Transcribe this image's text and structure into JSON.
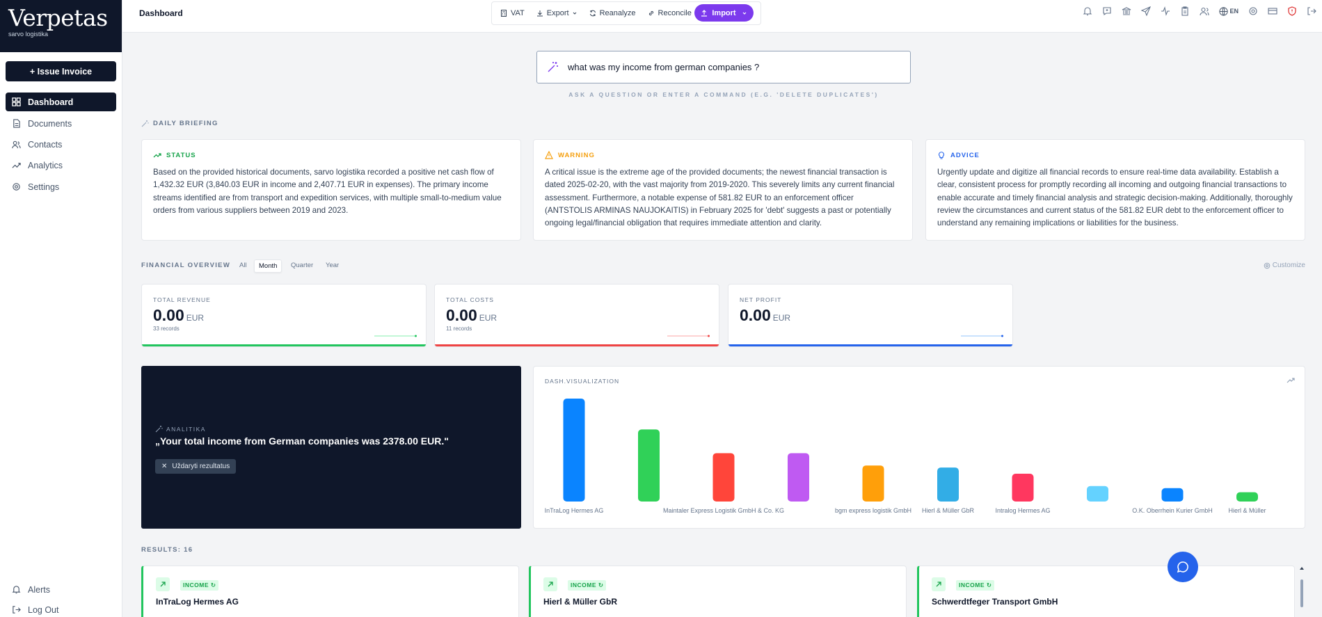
{
  "sidebar": {
    "brand": "Verpetas",
    "company": "sarvo logistika",
    "issue_invoice": "+ Issue Invoice",
    "nav": [
      {
        "label": "Dashboard",
        "icon": "grid-icon",
        "active": true
      },
      {
        "label": "Documents",
        "icon": "document-icon"
      },
      {
        "label": "Contacts",
        "icon": "users-icon"
      },
      {
        "label": "Analytics",
        "icon": "trend-icon"
      },
      {
        "label": "Settings",
        "icon": "gear-icon"
      }
    ],
    "bottom": [
      {
        "label": "Alerts",
        "icon": "bell-icon"
      },
      {
        "label": "Log Out",
        "icon": "logout-icon"
      }
    ]
  },
  "topbar": {
    "title": "Dashboard",
    "toolbar": {
      "vat": "VAT",
      "export": "Export",
      "reanalyze": "Reanalyze",
      "reconcile": "Reconcile",
      "import": "Import"
    },
    "lang": "EN",
    "icons": [
      "bell-icon",
      "message-icon",
      "bank-icon",
      "send-icon",
      "activity-icon",
      "clipboard-icon",
      "user-icon",
      "globe-icon",
      "gear-icon",
      "card-icon",
      "shield-alert-icon",
      "logout-icon"
    ]
  },
  "ask": {
    "value": "what was my income from german companies ?",
    "hint": "ASK A QUESTION OR ENTER A COMMAND (E.G. 'DELETE DUPLICATES')"
  },
  "briefing": {
    "label": "DAILY BRIEFING",
    "cards": [
      {
        "title": "STATUS",
        "color": "#16a34a",
        "text": "Based on the provided historical documents, sarvo logistika recorded a positive net cash flow of 1,432.32 EUR (3,840.03 EUR in income and 2,407.71 EUR in expenses). The primary income streams identified are from transport and expedition services, with multiple small-to-medium value orders from various suppliers between 2019 and 2023."
      },
      {
        "title": "WARNING",
        "color": "#f59e0b",
        "text": "A critical issue is the extreme age of the provided documents; the newest financial transaction is dated 2025-02-20, with the vast majority from 2019-2020. This severely limits any current financial assessment. Furthermore, a notable expense of 581.82 EUR to an enforcement officer (ANTSTOLIS ARMINAS NAUJOKAITIS) in February 2025 for 'debt' suggests a past or potentially ongoing legal/financial obligation that requires immediate attention and clarity."
      },
      {
        "title": "ADVICE",
        "color": "#2563eb",
        "text": "Urgently update and digitize all financial records to ensure real-time data availability. Establish a clear, consistent process for promptly recording all incoming and outgoing financial transactions to enable accurate and timely financial analysis and strategic decision-making. Additionally, thoroughly review the circumstances and current status of the 581.82 EUR debt to the enforcement officer to understand any remaining implications or liabilities for the business."
      }
    ]
  },
  "overview": {
    "label": "FINANCIAL OVERVIEW",
    "periods": [
      "All",
      "Month",
      "Quarter",
      "Year"
    ],
    "active_period": "Month",
    "customize": "Customize",
    "kpis": [
      {
        "label": "TOTAL REVENUE",
        "value": "0.00",
        "unit": "EUR",
        "records": "33 records",
        "color": "#22c55e"
      },
      {
        "label": "TOTAL COSTS",
        "value": "0.00",
        "unit": "EUR",
        "records": "11 records",
        "color": "#ef4444"
      },
      {
        "label": "NET PROFIT",
        "value": "0.00",
        "unit": "EUR",
        "records": "",
        "color": "#2563eb"
      }
    ]
  },
  "analitika": {
    "label": "ANALITIKA",
    "answer": "„Your total income from German companies was 2378.00 EUR.\"",
    "close": "Uždaryti rezultatus"
  },
  "viz": {
    "title": "DASH.VISUALIZATION"
  },
  "chart_data": {
    "type": "bar",
    "categories": [
      "InTraLog Hermes AG",
      "",
      "Maintaler Express Logistik GmbH & Co. KG",
      "",
      "bgm express logistik GmbH",
      "Hierl & Müller GbR",
      "Intralog Hermes AG",
      "",
      "O.K. Oberrhein Kurier GmbH",
      "Hierl & Müller"
    ],
    "values": [
      100,
      70,
      47,
      47,
      35,
      33,
      27,
      15,
      13,
      9
    ],
    "colors": [
      "#0a84ff",
      "#30d158",
      "#ff453a",
      "#bf5af2",
      "#ff9f0a",
      "#32ade6",
      "#ff375f",
      "#64d2ff",
      "#0a84ff",
      "#30d158"
    ],
    "title": "DASH.VISUALIZATION",
    "xlabel": "",
    "ylabel": "",
    "grid": false
  },
  "results": {
    "label": "RESULTS: 16",
    "items": [
      {
        "tag": "INCOME",
        "name": "InTraLog Hermes AG"
      },
      {
        "tag": "INCOME",
        "name": "Hierl & Müller GbR"
      },
      {
        "tag": "INCOME",
        "name": "Schwerdtfeger Transport GmbH"
      }
    ]
  }
}
